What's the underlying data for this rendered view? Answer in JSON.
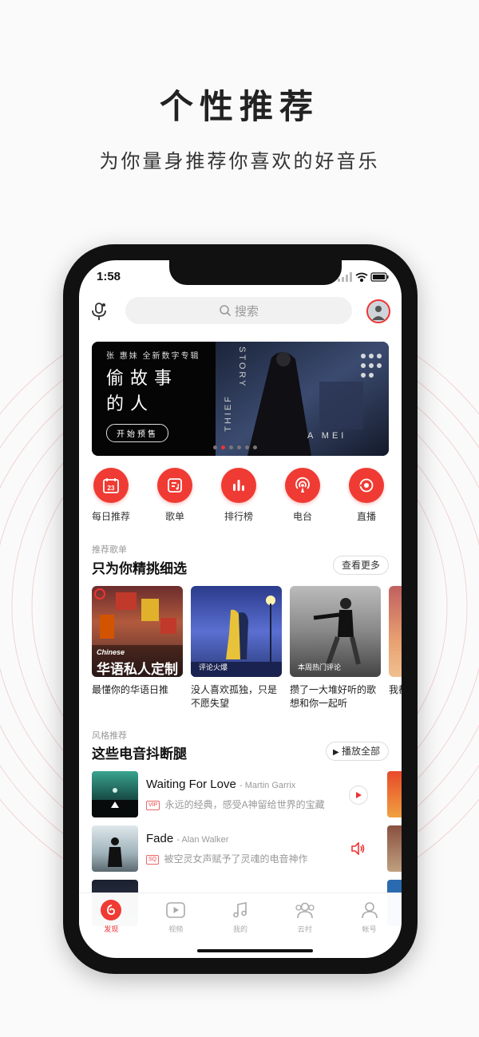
{
  "promo": {
    "title": "个性推荐",
    "subtitle": "为你量身推荐你喜欢的好音乐"
  },
  "status": {
    "time": "1:58"
  },
  "search": {
    "placeholder": "搜索"
  },
  "banner": {
    "artist_line": "张 惠妹 全新数字专辑",
    "album_title": "偷故事的人",
    "preorder_label": "开始预售",
    "story": "STORY",
    "thief": "THIEF",
    "amei": "A MEI",
    "dots_count": 6,
    "active_dot": 1
  },
  "quick": [
    {
      "label": "每日推荐",
      "icon": "calendar-icon",
      "day": "23"
    },
    {
      "label": "歌单",
      "icon": "playlist-icon"
    },
    {
      "label": "排行榜",
      "icon": "chart-icon"
    },
    {
      "label": "电台",
      "icon": "radio-icon"
    },
    {
      "label": "直播",
      "icon": "live-icon"
    }
  ],
  "recommend": {
    "subtitle": "推荐歌单",
    "title": "只为你精挑细选",
    "more_label": "查看更多",
    "playlists": [
      {
        "desc": "最懂你的华语日推",
        "cover_title": "华语私人定制",
        "cover_en": "Chinese"
      },
      {
        "desc": "没人喜欢孤独，只是不愿失望",
        "cover_label": "评论火爆"
      },
      {
        "desc": "攒了一大堆好听的歌想和你一起听",
        "cover_label": "本周热门评论"
      },
      {
        "desc": "我都不"
      }
    ]
  },
  "style": {
    "subtitle": "风格推荐",
    "title": "这些电音抖断腿",
    "play_all_label": "播放全部",
    "songs": [
      {
        "title": "Waiting For Love",
        "artist": "- Martin Garrix",
        "tag": "VIP",
        "desc": "永远的经典，感受A神留给世界的宝藏",
        "action": "play-icon"
      },
      {
        "title": "Fade",
        "artist": "- Alan Walker",
        "tag": "SQ",
        "desc": "被空灵女声赋予了灵魂的电音神作",
        "action": "speaker-icon"
      },
      {
        "title": "",
        "artist": "",
        "tag": "",
        "desc": ""
      }
    ]
  },
  "tabs": [
    {
      "label": "发现",
      "icon": "netease-logo-icon",
      "active": true
    },
    {
      "label": "视频",
      "icon": "video-icon"
    },
    {
      "label": "我的",
      "icon": "music-note-icon"
    },
    {
      "label": "云村",
      "icon": "community-icon"
    },
    {
      "label": "帐号",
      "icon": "user-icon"
    }
  ],
  "colors": {
    "accent": "#ef3b33",
    "text": "#222222",
    "muted": "#999999"
  }
}
